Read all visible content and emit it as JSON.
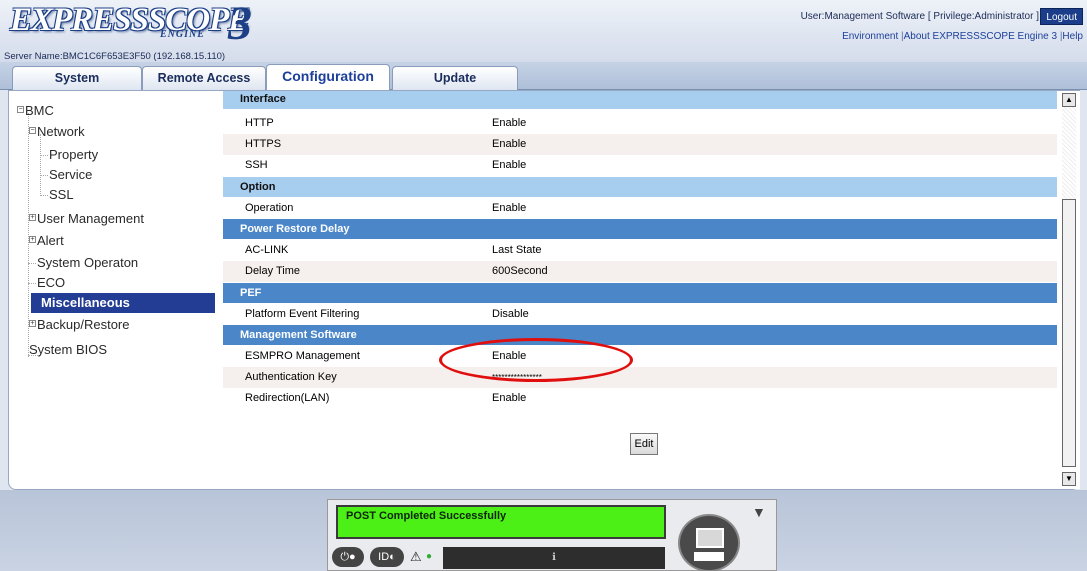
{
  "header": {
    "logo_text": "EXPRESSSCOPE",
    "logo_sub": "ENGINE",
    "logo_num": "3",
    "user_line": "User:Management Software [ Privilege:Administrator ]",
    "logout_label": "Logout",
    "links": [
      "Environment",
      "About EXPRESSSCOPE Engine 3",
      "Help"
    ],
    "server_name": "Server Name:BMC1C6F653E3F50 (192.168.15.110)"
  },
  "tabs": [
    "System",
    "Remote Access",
    "Configuration",
    "Update"
  ],
  "active_tab": "Configuration",
  "tree": {
    "bmc": "BMC",
    "network": "Network",
    "property": "Property",
    "service": "Service",
    "ssl": "SSL",
    "user_management": "User Management",
    "alert": "Alert",
    "system_operaton": "System Operaton",
    "eco": "ECO",
    "miscellaneous": "Miscellaneous",
    "backup_restore": "Backup/Restore",
    "system_bios": "System BIOS"
  },
  "content": {
    "interface": {
      "title": "Interface",
      "rows": [
        {
          "key": "HTTP",
          "value": "Enable"
        },
        {
          "key": "HTTPS",
          "value": "Enable"
        },
        {
          "key": "SSH",
          "value": "Enable"
        }
      ]
    },
    "option": {
      "title": "Option",
      "rows": [
        {
          "key": "Operation",
          "value": "Enable"
        }
      ]
    },
    "power": {
      "title": "Power Restore Delay",
      "rows": [
        {
          "key": "AC-LINK",
          "value": "Last State"
        },
        {
          "key": "Delay Time",
          "value": "600Second"
        }
      ]
    },
    "pef": {
      "title": "PEF",
      "rows": [
        {
          "key": "Platform Event Filtering",
          "value": "Disable"
        }
      ]
    },
    "mgmt": {
      "title": "Management Software",
      "rows": [
        {
          "key": "ESMPRO Management",
          "value": "Enable"
        },
        {
          "key": "Authentication Key",
          "value": "****************"
        },
        {
          "key": "Redirection(LAN)",
          "value": "Enable"
        }
      ]
    },
    "edit_label": "Edit"
  },
  "status": {
    "post_message": "POST Completed Successfully",
    "id_label": "ID"
  },
  "colors": {
    "section_light": "#a7cdef",
    "section_dark": "#4a86c8",
    "selected": "#233d94",
    "post_green": "#4cf016",
    "annotation_red": "#e10e0e"
  }
}
